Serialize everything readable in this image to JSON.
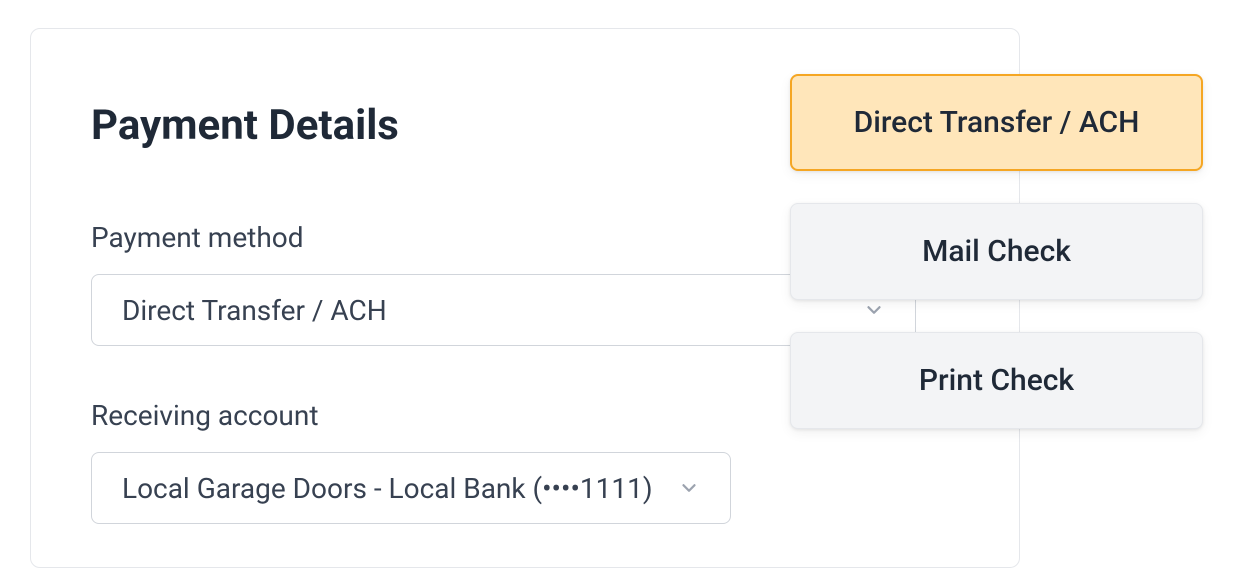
{
  "panel": {
    "title": "Payment Details"
  },
  "fields": {
    "method": {
      "label": "Payment method",
      "value": "Direct Transfer / ACH"
    },
    "account": {
      "label": "Receiving account",
      "value": "Local Garage Doors - Local Bank (••••1111)"
    }
  },
  "menu": {
    "options": [
      {
        "label": "Direct Transfer / ACH",
        "selected": true
      },
      {
        "label": "Mail Check",
        "selected": false
      },
      {
        "label": "Print Check",
        "selected": false
      }
    ]
  }
}
